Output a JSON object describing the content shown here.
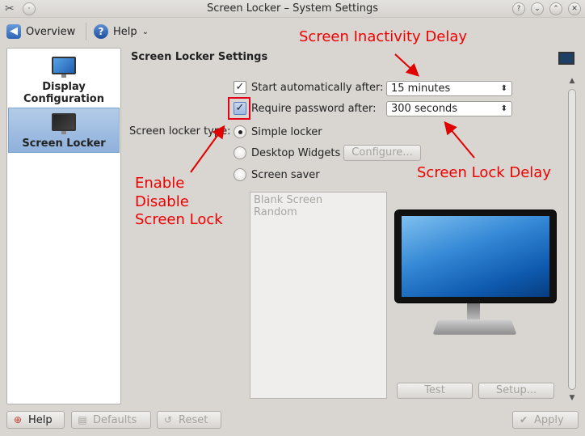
{
  "window": {
    "title": "Screen Locker – System Settings"
  },
  "toolbar": {
    "overview_label": "Overview",
    "help_label": "Help"
  },
  "sidebar": {
    "items": [
      {
        "label_line1": "Display",
        "label_line2": "Configuration",
        "icon": "monitor-icon"
      },
      {
        "label": "Screen Locker",
        "icon": "screen-locker-icon",
        "active": true
      }
    ]
  },
  "main": {
    "section_title": "Screen Locker Settings",
    "start_auto": {
      "label": "Start automatically after:",
      "checked": true,
      "value": "15 minutes"
    },
    "require_password": {
      "label": "Require password after:",
      "checked": true,
      "value": "300 seconds"
    },
    "locker_type_label": "Screen locker type:",
    "options": [
      {
        "label": "Simple locker",
        "checked": true
      },
      {
        "label": "Desktop Widgets",
        "checked": false
      },
      {
        "label": "Screen saver",
        "checked": false
      }
    ],
    "configure_label": "Configure...",
    "saver_list": [
      "Blank Screen",
      "Random"
    ],
    "test_label": "Test",
    "setup_label": "Setup..."
  },
  "annotations": {
    "inactivity": "Screen Inactivity Delay",
    "lock_delay": "Screen Lock Delay",
    "enable_line1": "Enable",
    "enable_line2": "Disable",
    "enable_line3": "Screen Lock",
    "color": "#e00000"
  },
  "bottom": {
    "help_label": "Help",
    "defaults_label": "Defaults",
    "reset_label": "Reset",
    "apply_label": "Apply"
  }
}
